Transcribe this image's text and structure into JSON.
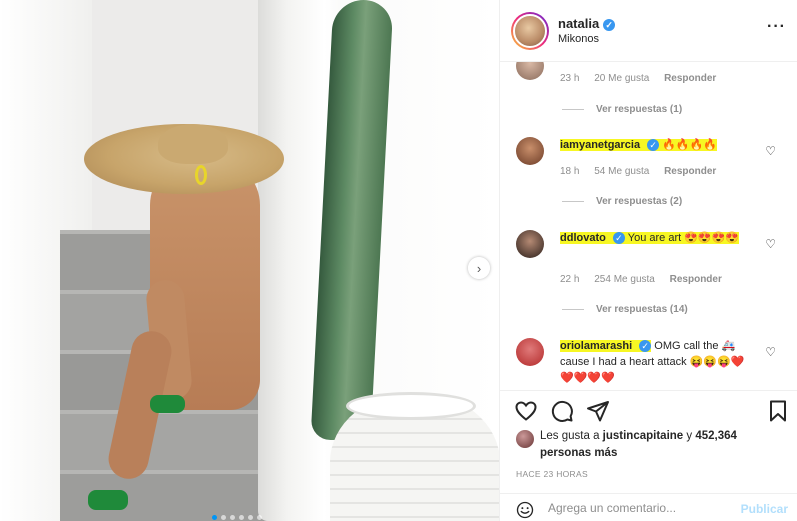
{
  "post": {
    "username": "natalia",
    "location": "Mikonos",
    "more_icon": "more-options-icon"
  },
  "comments": [
    {
      "meta": {
        "time": "23 h",
        "likes": "20 Me gusta",
        "reply": "Responder"
      },
      "view_replies": "Ver respuestas (1)"
    },
    {
      "user": "iamyanetgarcia",
      "text": "🔥🔥🔥🔥",
      "meta": {
        "time": "18 h",
        "likes": "54 Me gusta",
        "reply": "Responder"
      },
      "view_replies": "Ver respuestas (2)"
    },
    {
      "user": "ddlovato",
      "text": "You are art 😍😍😍😍",
      "meta": {
        "time": "22 h",
        "likes": "254 Me gusta",
        "reply": "Responder"
      },
      "view_replies": "Ver respuestas (14)"
    },
    {
      "user": "oriolamarashi",
      "text": "OMG call the 🚑 cause I had a heart attack 😝😝😝❤️❤️❤️❤️❤️"
    }
  ],
  "likes": {
    "prefix": "Les gusta a",
    "user": "justincapitaine",
    "joiner": "y",
    "count": "452,364 personas más"
  },
  "timestamp": "HACE 23 HORAS",
  "add_comment": {
    "placeholder": "Agrega un comentario...",
    "publish_label": "Publicar"
  },
  "colors": {
    "highlight": "#f7f723",
    "verified": "#3897f0",
    "publish_disabled": "#b2dffc"
  }
}
